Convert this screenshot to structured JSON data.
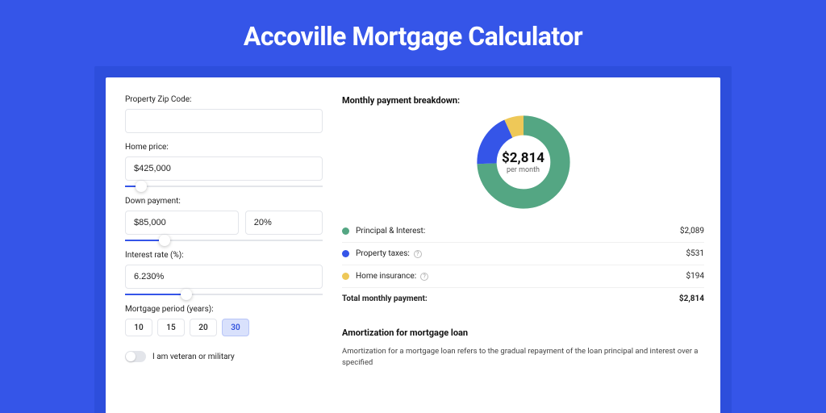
{
  "page_title": "Accoville Mortgage Calculator",
  "form": {
    "zip_label": "Property Zip Code:",
    "zip_value": "",
    "home_price_label": "Home price:",
    "home_price_value": "$425,000",
    "home_price_slider_pct": 8,
    "down_payment_label": "Down payment:",
    "down_payment_value": "$85,000",
    "down_payment_pct_value": "20%",
    "down_payment_slider_pct": 20,
    "interest_label": "Interest rate (%):",
    "interest_value": "6.230%",
    "interest_slider_pct": 31,
    "period_label": "Mortgage period (years):",
    "periods": [
      {
        "label": "10",
        "active": false
      },
      {
        "label": "15",
        "active": false
      },
      {
        "label": "20",
        "active": false
      },
      {
        "label": "30",
        "active": true
      }
    ],
    "veteran_label": "I am veteran or military"
  },
  "breakdown": {
    "title": "Monthly payment breakdown:",
    "center_amount": "$2,814",
    "center_sub": "per month",
    "rows": [
      {
        "label": "Principal & Interest:",
        "value": "$2,089",
        "color": "#54a683",
        "help": false
      },
      {
        "label": "Property taxes:",
        "value": "$531",
        "color": "#3555e8",
        "help": true
      },
      {
        "label": "Home insurance:",
        "value": "$194",
        "color": "#eec858",
        "help": true
      }
    ],
    "total_label": "Total monthly payment:",
    "total_value": "$2,814"
  },
  "chart_data": {
    "type": "pie",
    "title": "Monthly payment breakdown",
    "series": [
      {
        "name": "Principal & Interest",
        "value": 2089,
        "color": "#54a683"
      },
      {
        "name": "Property taxes",
        "value": 531,
        "color": "#3555e8"
      },
      {
        "name": "Home insurance",
        "value": 194,
        "color": "#eec858"
      }
    ],
    "total": 2814
  },
  "amort": {
    "title": "Amortization for mortgage loan",
    "text": "Amortization for a mortgage loan refers to the gradual repayment of the loan principal and interest over a specified"
  }
}
